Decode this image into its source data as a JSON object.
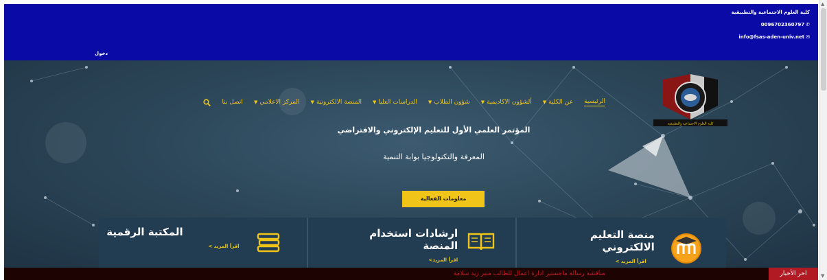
{
  "topbar": {
    "college_name": "كلية العلوم الاجتماعية والتطبيقية",
    "phone": "0096702360797",
    "email": "info@fsas-aden-univ.net",
    "login": "دخول",
    "background": "#0a0aa6"
  },
  "logo": {
    "caption": "كلية العلوم الاجتماعية والتطبيقية",
    "ring_text": "University of Aden"
  },
  "nav": {
    "items": [
      {
        "label": "الرئيسية",
        "active": true,
        "dropdown": false
      },
      {
        "label": "عن الكلية",
        "dropdown": true
      },
      {
        "label": "ألشؤون الاكاديمية",
        "dropdown": true
      },
      {
        "label": "شؤون الطلاب",
        "dropdown": true
      },
      {
        "label": "الدراسات العليا",
        "dropdown": true
      },
      {
        "label": "المنصة الالكترونية",
        "dropdown": true
      },
      {
        "label": "المركز الاعلامي",
        "dropdown": true
      },
      {
        "label": "اتصل بنا",
        "dropdown": false
      }
    ],
    "search_icon": "search-icon",
    "accent": "#f0c419"
  },
  "hero": {
    "headline": "المؤتمر العلمي الأول للتعليم الإلكتروني والافتراضي",
    "subline": "المعرفة والتكنولوجيا بوابة التنمية",
    "button": "معلومات الفعالية"
  },
  "panels": [
    {
      "title_line1": "منصة التعليم",
      "title_line2": "الالكتروني",
      "more": "اقرأ المزيد >",
      "icon": "moodle-icon"
    },
    {
      "title_line1": "ارشادات استخدام",
      "title_line2": "المنصة",
      "more": "اقرأ المزيد>",
      "icon": "book-icon"
    },
    {
      "title_line1": "المكتبة الرقمية",
      "title_line2": "",
      "more": "اقرأ المزيد >",
      "icon": "books-stack-icon"
    }
  ],
  "ticker": {
    "label": "اخر الأخبار",
    "news": "مناقشة رسالة ماجستير ادارة اعمال للطالب منير زيد سلامة"
  }
}
